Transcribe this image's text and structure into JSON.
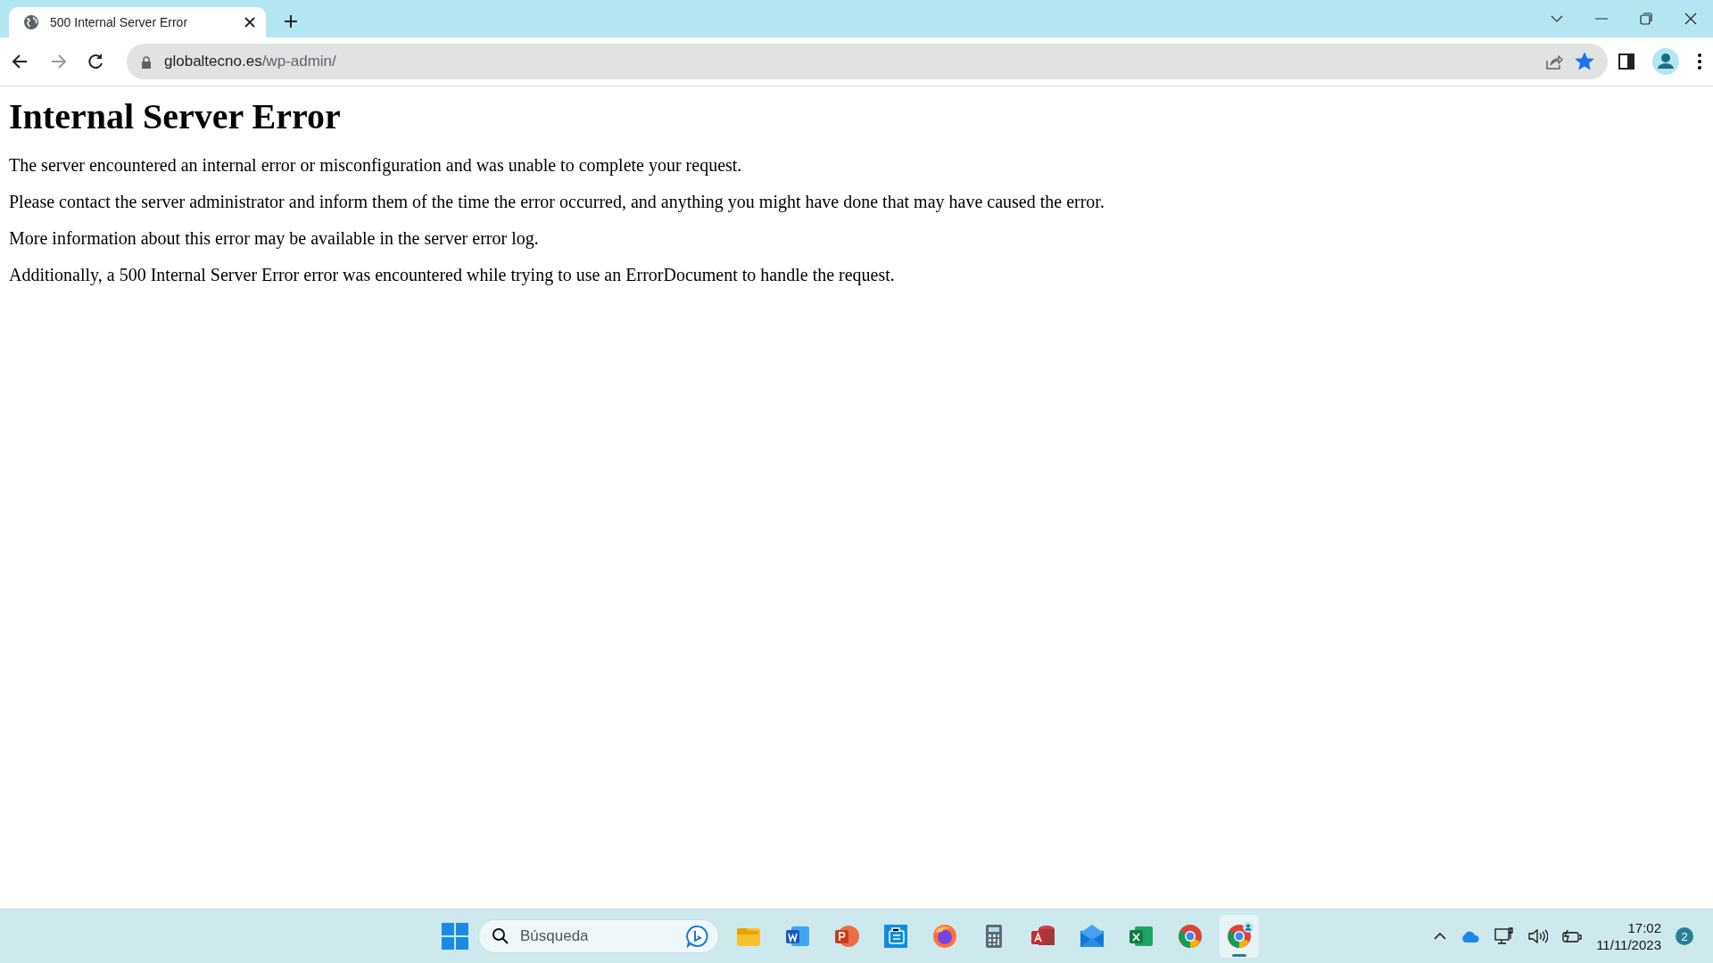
{
  "tab": {
    "title": "500 Internal Server Error",
    "selected": true
  },
  "address_bar": {
    "host": "globaltecno.es",
    "path": "/wp-admin/",
    "bookmarked": true
  },
  "page": {
    "heading": "Internal Server Error",
    "paragraphs": [
      "The server encountered an internal error or misconfiguration and was unable to complete your request.",
      "Please contact the server administrator and inform them of the time the error occurred, and anything you might have done that may have caused the error.",
      "More information about this error may be available in the server error log.",
      "Additionally, a 500 Internal Server Error error was encountered while trying to use an ErrorDocument to handle the request."
    ]
  },
  "taskbar": {
    "search": {
      "placeholder": "Búsqueda"
    },
    "apps": [
      {
        "kind": "files",
        "active": false
      },
      {
        "kind": "word",
        "active": false
      },
      {
        "kind": "powerpoint",
        "active": false
      },
      {
        "kind": "store",
        "active": false
      },
      {
        "kind": "firefox",
        "active": false
      },
      {
        "kind": "calculator",
        "active": false
      },
      {
        "kind": "access",
        "active": false
      },
      {
        "kind": "mail",
        "active": false
      },
      {
        "kind": "excel",
        "active": false
      },
      {
        "kind": "chrome",
        "active": false
      },
      {
        "kind": "chrome-profile",
        "active": true
      }
    ],
    "time": "17:02",
    "date": "11/11/2023",
    "notifications": "2"
  }
}
